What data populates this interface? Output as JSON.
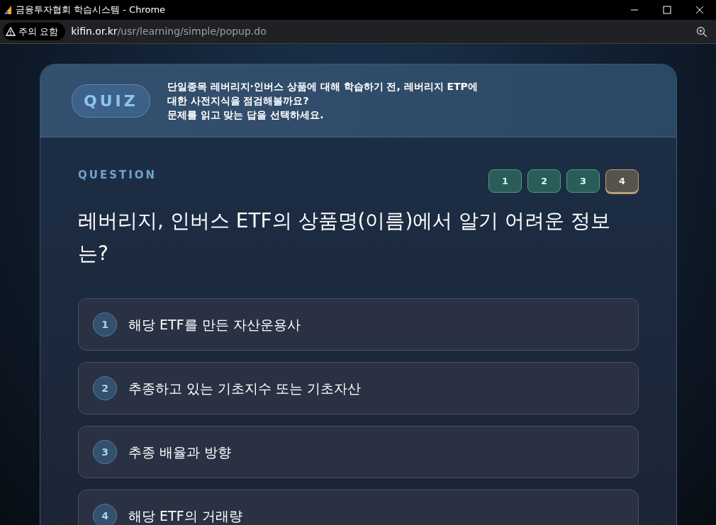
{
  "window": {
    "title": "금융투자협회 학습시스템 - Chrome"
  },
  "address_bar": {
    "security_label": "주의 요함",
    "url_host": "kifin.or.kr",
    "url_path": "/usr/learning/simple/popup.do"
  },
  "quiz_header": {
    "badge": "QUIZ",
    "lines": [
      "단일종목 레버리지·인버스 상품에 대해 학습하기 전, 레버리지 ETP에",
      "대한 사전지식을 점검해볼까요?",
      "문제를 읽고 맞는 답을 선택하세요."
    ]
  },
  "question": {
    "label": "QUESTION",
    "text": "레버리지, 인버스 ETF의 상품명(이름)에서 알기 어려운 정보는?"
  },
  "question_tabs": [
    {
      "label": "1",
      "selected": false
    },
    {
      "label": "2",
      "selected": false
    },
    {
      "label": "3",
      "selected": false
    },
    {
      "label": "4",
      "selected": true
    }
  ],
  "options": [
    {
      "number": "1",
      "text": "해당 ETF를 만든 자산운용사"
    },
    {
      "number": "2",
      "text": "추종하고 있는 기초지수 또는 기초자산"
    },
    {
      "number": "3",
      "text": "추종 배율과 방향"
    },
    {
      "number": "4",
      "text": "해당 ETF의 거래량"
    }
  ]
}
